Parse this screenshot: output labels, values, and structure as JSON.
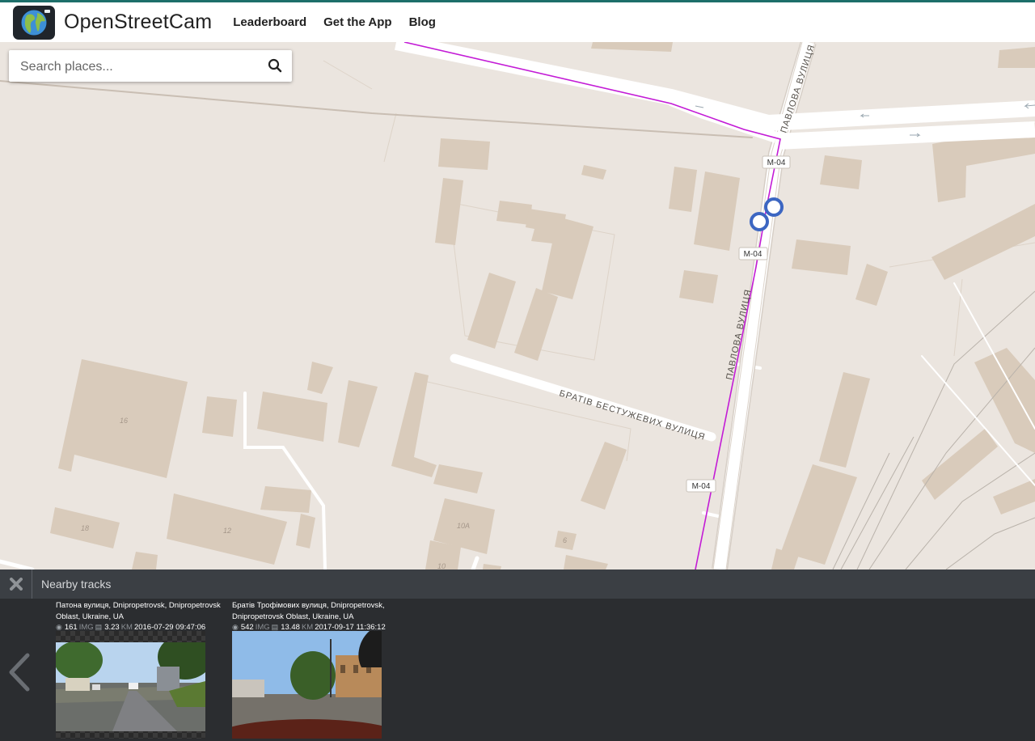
{
  "header": {
    "brand": "OpenStreetCam",
    "nav": [
      {
        "label": "Leaderboard"
      },
      {
        "label": "Get the App"
      },
      {
        "label": "Blog"
      }
    ]
  },
  "search": {
    "placeholder": "Search places..."
  },
  "map": {
    "road_labels": {
      "pavlova_top": "ПАВЛОВА ВУЛИЦЯ",
      "pavlova_mid": "ПАВЛОВА ВУЛИЦЯ",
      "brativ": "БРАТІВ БЕСТУЖЕВИХ ВУЛИЦЯ"
    },
    "shields": [
      "М-04",
      "М-04",
      "М-04"
    ],
    "house_numbers": [
      "16",
      "12",
      "18",
      "10А",
      "6",
      "10"
    ]
  },
  "panel": {
    "title": "Nearby tracks",
    "tracks": [
      {
        "address": "Патона вулиця, Dnipropetrovsk, Dnipropetrovsk Oblast, Ukraine, UA",
        "images": "161",
        "images_unit": "IMG",
        "distance": "3.23",
        "distance_unit": "KM",
        "date": "2016-07-29 09:47:06"
      },
      {
        "address": "Братів Трофімових вулиця, Dnipropetrovsk, Dnipropetrovsk Oblast, Ukraine, UA",
        "images": "542",
        "images_unit": "IMG",
        "distance": "13.48",
        "distance_unit": "KM",
        "date": "2017-09-17 11:36:12"
      }
    ]
  },
  "colors": {
    "map_bg": "#ebe5df",
    "building": "#d9cbbb",
    "track_line": "#c31bd6",
    "marker": "#3c66c2",
    "panel_bar": "#3b3f44",
    "panel_body": "#2b2d30"
  }
}
